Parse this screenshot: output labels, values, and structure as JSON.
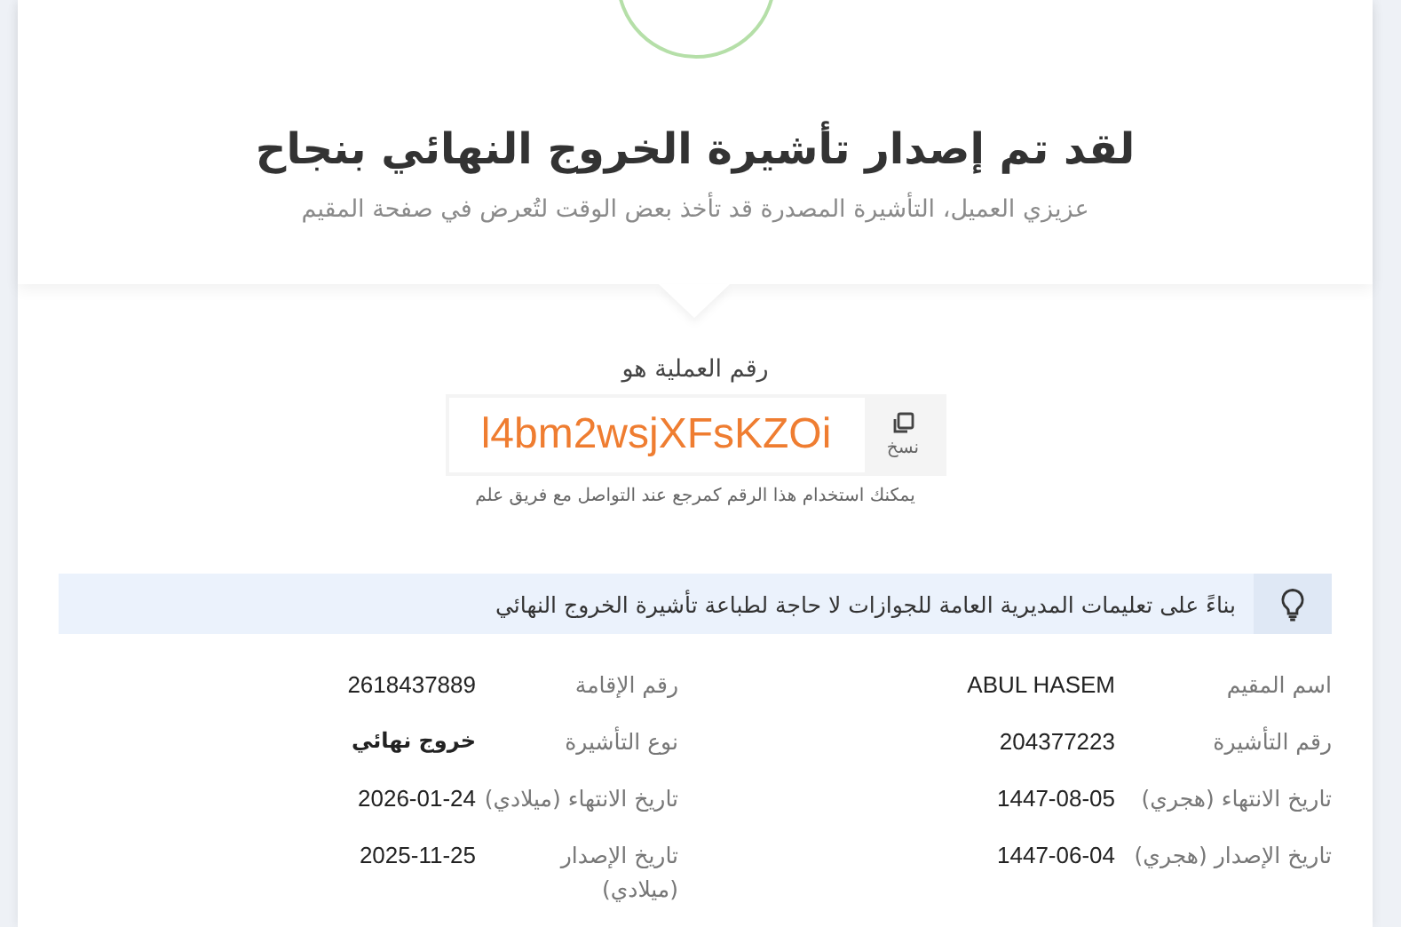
{
  "header": {
    "title": "لقد تم إصدار تأشيرة الخروج النهائي بنجاح",
    "subtitle": "عزيزي العميل، التأشيرة المصدرة قد تأخذ بعض الوقت لتُعرض في صفحة المقيم"
  },
  "transaction": {
    "label": "رقم العملية هو",
    "code": "l4bm2wsjXFsKZOi",
    "copy_label": "نسخ",
    "hint": "يمكنك استخدام هذا الرقم كمرجع عند التواصل مع فريق علم"
  },
  "notice": {
    "text": "بناءً على تعليمات المديرية العامة للجوازات لا حاجة لطباعة تأشيرة الخروج النهائي"
  },
  "details": [
    {
      "label": "اسم المقيم",
      "value": "ABUL HASEM",
      "bold": false
    },
    {
      "label": "رقم الإقامة",
      "value": "2618437889",
      "bold": false
    },
    {
      "label": "رقم التأشيرة",
      "value": "204377223",
      "bold": false
    },
    {
      "label": "نوع التأشيرة",
      "value": "خروج نهائي",
      "bold": true
    },
    {
      "label": "تاريخ الانتهاء (هجري)",
      "value": "1447-08-05",
      "bold": false
    },
    {
      "label": "تاريخ الانتهاء (ميلادي)",
      "value": "2026-01-24",
      "bold": false
    },
    {
      "label": "تاريخ الإصدار (هجري)",
      "value": "1447-06-04",
      "bold": false
    },
    {
      "label": "تاريخ الإصدار (ميلادي)",
      "value": "2025-11-25",
      "bold": false
    }
  ]
}
